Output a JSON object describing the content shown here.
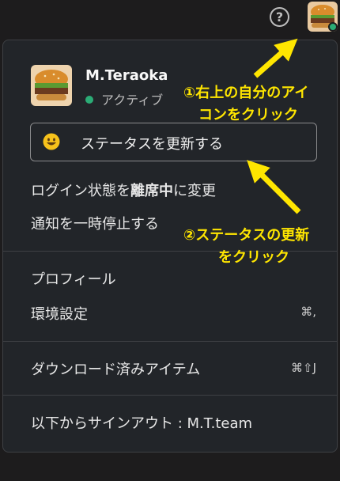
{
  "topbar": {
    "help_icon": "question-circle-icon",
    "avatar_icon": "hamburger-avatar-icon"
  },
  "menu": {
    "profile": {
      "name": "M.Teraoka",
      "status": "アクティブ",
      "status_color": "#2bac76"
    },
    "status_button": {
      "emoji": "smiley-emoji-icon",
      "label": "ステータスを更新する"
    },
    "away": {
      "prefix": "ログイン状態を",
      "bold": "離席中",
      "suffix": "に変更"
    },
    "pause_notifications": "通知を一時停止する",
    "profile_link": "プロフィール",
    "preferences": {
      "label": "環境設定",
      "shortcut": "⌘,"
    },
    "downloads": {
      "label": "ダウンロード済みアイテム",
      "shortcut": "⌘⇧J"
    },
    "signout": "以下からサインアウト : M.T.team"
  },
  "annotations": {
    "step1_line1": "①右上の自分のアイ",
    "step1_line2": "コンをクリック",
    "step2_line1": "②ステータスの更新",
    "step2_line2": "をクリック",
    "color": "#ffe600"
  }
}
